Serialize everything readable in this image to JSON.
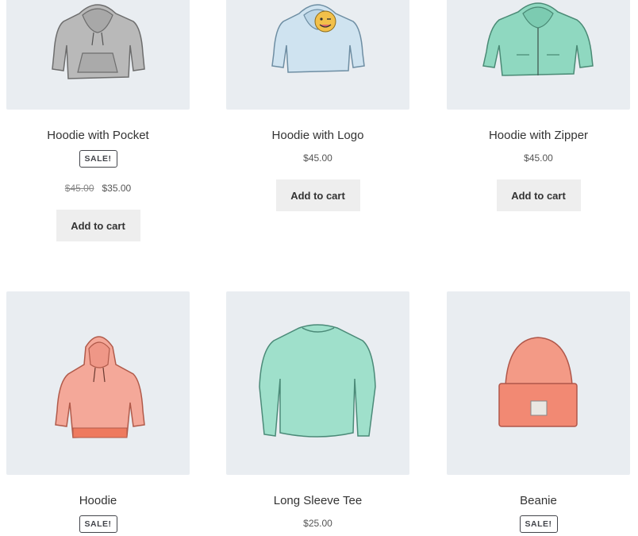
{
  "products": [
    {
      "name": "Hoodie with Pocket",
      "sale_badge": "SALE!",
      "old_price": "$45.00",
      "price": "$35.00",
      "button": "Add to cart",
      "image_icon": "gray-hoodie-pocket-icon"
    },
    {
      "name": "Hoodie with Logo",
      "price": "$45.00",
      "button": "Add to cart",
      "image_icon": "blue-hoodie-logo-icon"
    },
    {
      "name": "Hoodie with Zipper",
      "price": "$45.00",
      "button": "Add to cart",
      "image_icon": "mint-hoodie-zipper-icon"
    },
    {
      "name": "Hoodie",
      "sale_badge": "SALE!",
      "image_icon": "pink-hoodie-icon"
    },
    {
      "name": "Long Sleeve Tee",
      "price": "$25.00",
      "image_icon": "mint-long-sleeve-tee-icon"
    },
    {
      "name": "Beanie",
      "sale_badge": "SALE!",
      "image_icon": "orange-beanie-icon"
    }
  ],
  "colors": {
    "tile_background": "#e9edf1",
    "button_background": "#eeeeee",
    "text": "#43454b"
  }
}
